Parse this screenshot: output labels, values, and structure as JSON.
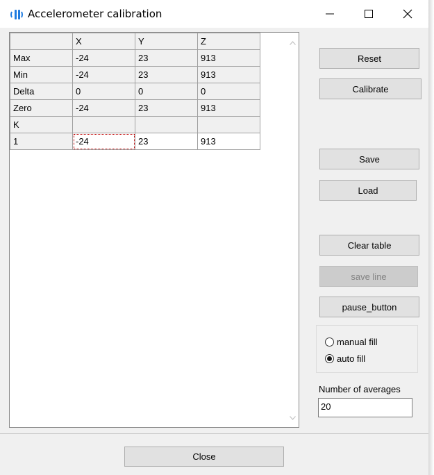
{
  "window": {
    "title": "Accelerometer calibration",
    "icon": "accelerometer-app-icon",
    "controls": {
      "minimize": "minimize-icon",
      "maximize": "maximize-icon",
      "close": "close-icon"
    }
  },
  "grid": {
    "columns": [
      "",
      "X",
      "Y",
      "Z"
    ],
    "rows": [
      {
        "label": "Max",
        "x": "-24",
        "y": "23",
        "z": "913"
      },
      {
        "label": "Min",
        "x": "-24",
        "y": "23",
        "z": "913"
      },
      {
        "label": "Delta",
        "x": "0",
        "y": "0",
        "z": "0"
      },
      {
        "label": "Zero",
        "x": "-24",
        "y": "23",
        "z": "913"
      },
      {
        "label": "K",
        "x": "",
        "y": "",
        "z": ""
      },
      {
        "label": "1",
        "x": "-24",
        "y": "23",
        "z": "913"
      }
    ]
  },
  "buttons": {
    "reset": "Reset",
    "calibrate": "Calibrate",
    "save": "Save",
    "load": "Load",
    "clear_table": "Clear table",
    "save_line": "save line",
    "pause": "pause_button",
    "close": "Close"
  },
  "fill_mode": {
    "manual_label": "manual fill",
    "auto_label": "auto fill",
    "selected": "auto"
  },
  "averages": {
    "label": "Number of averages",
    "value": "20"
  }
}
